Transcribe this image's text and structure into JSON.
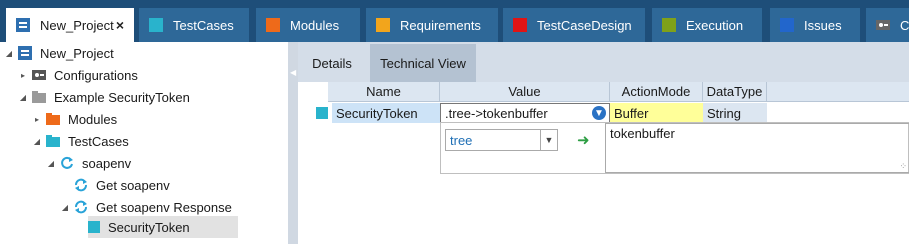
{
  "tabs": [
    {
      "label": "New_Project",
      "color": "#2e6fb0",
      "active": true
    },
    {
      "label": "TestCases",
      "color": "#29b3cc"
    },
    {
      "label": "Modules",
      "color": "#ee6a1a"
    },
    {
      "label": "Requirements",
      "color": "#f2a51c"
    },
    {
      "label": "TestCaseDesign",
      "color": "#e01414"
    },
    {
      "label": "Execution",
      "color": "#7fa11a"
    },
    {
      "label": "Issues",
      "color": "#2266cc"
    },
    {
      "label": "Co",
      "icon": "config-icon"
    }
  ],
  "tab_close": "×",
  "tree": {
    "items": [
      {
        "label": "New_Project",
        "icon": "project-icon",
        "expander": "expanded"
      },
      {
        "label": "Configurations",
        "icon": "config-icon",
        "expander": "collapsed"
      },
      {
        "label": "Example SecurityToken",
        "icon": "folder-gray-icon",
        "expander": "expanded"
      },
      {
        "label": "Modules",
        "icon": "folder-orange-icon",
        "expander": "collapsed"
      },
      {
        "label": "TestCases",
        "icon": "folder-teal-icon",
        "expander": "expanded"
      },
      {
        "label": "soapenv",
        "icon": "refresh-icon",
        "expander": "expanded"
      },
      {
        "label": "Get soapenv",
        "icon": "refresh-icon",
        "expander": "none"
      },
      {
        "label": "Get soapenv Response",
        "icon": "refresh-icon",
        "expander": "expanded"
      },
      {
        "label": "SecurityToken",
        "icon": "attribute-icon",
        "expander": "none",
        "selected": true
      }
    ]
  },
  "details": {
    "tabs": [
      "Details",
      "Technical View"
    ],
    "active_tab": "Details",
    "columns": [
      "Name",
      "Value",
      "ActionMode",
      "DataType"
    ],
    "row": {
      "name": "SecurityToken",
      "value": ".tree->tokenbuffer",
      "action_mode": "Buffer",
      "data_type": "String"
    },
    "editor": {
      "combo_value": "tree",
      "target_value": "tokenbuffer"
    }
  },
  "colors": {
    "tabbar": "#1e4e79",
    "tab": "#2e6898",
    "action_mode_bg": "#ffff99",
    "name_bg": "#cde3f7",
    "teal": "#29b3cc"
  }
}
